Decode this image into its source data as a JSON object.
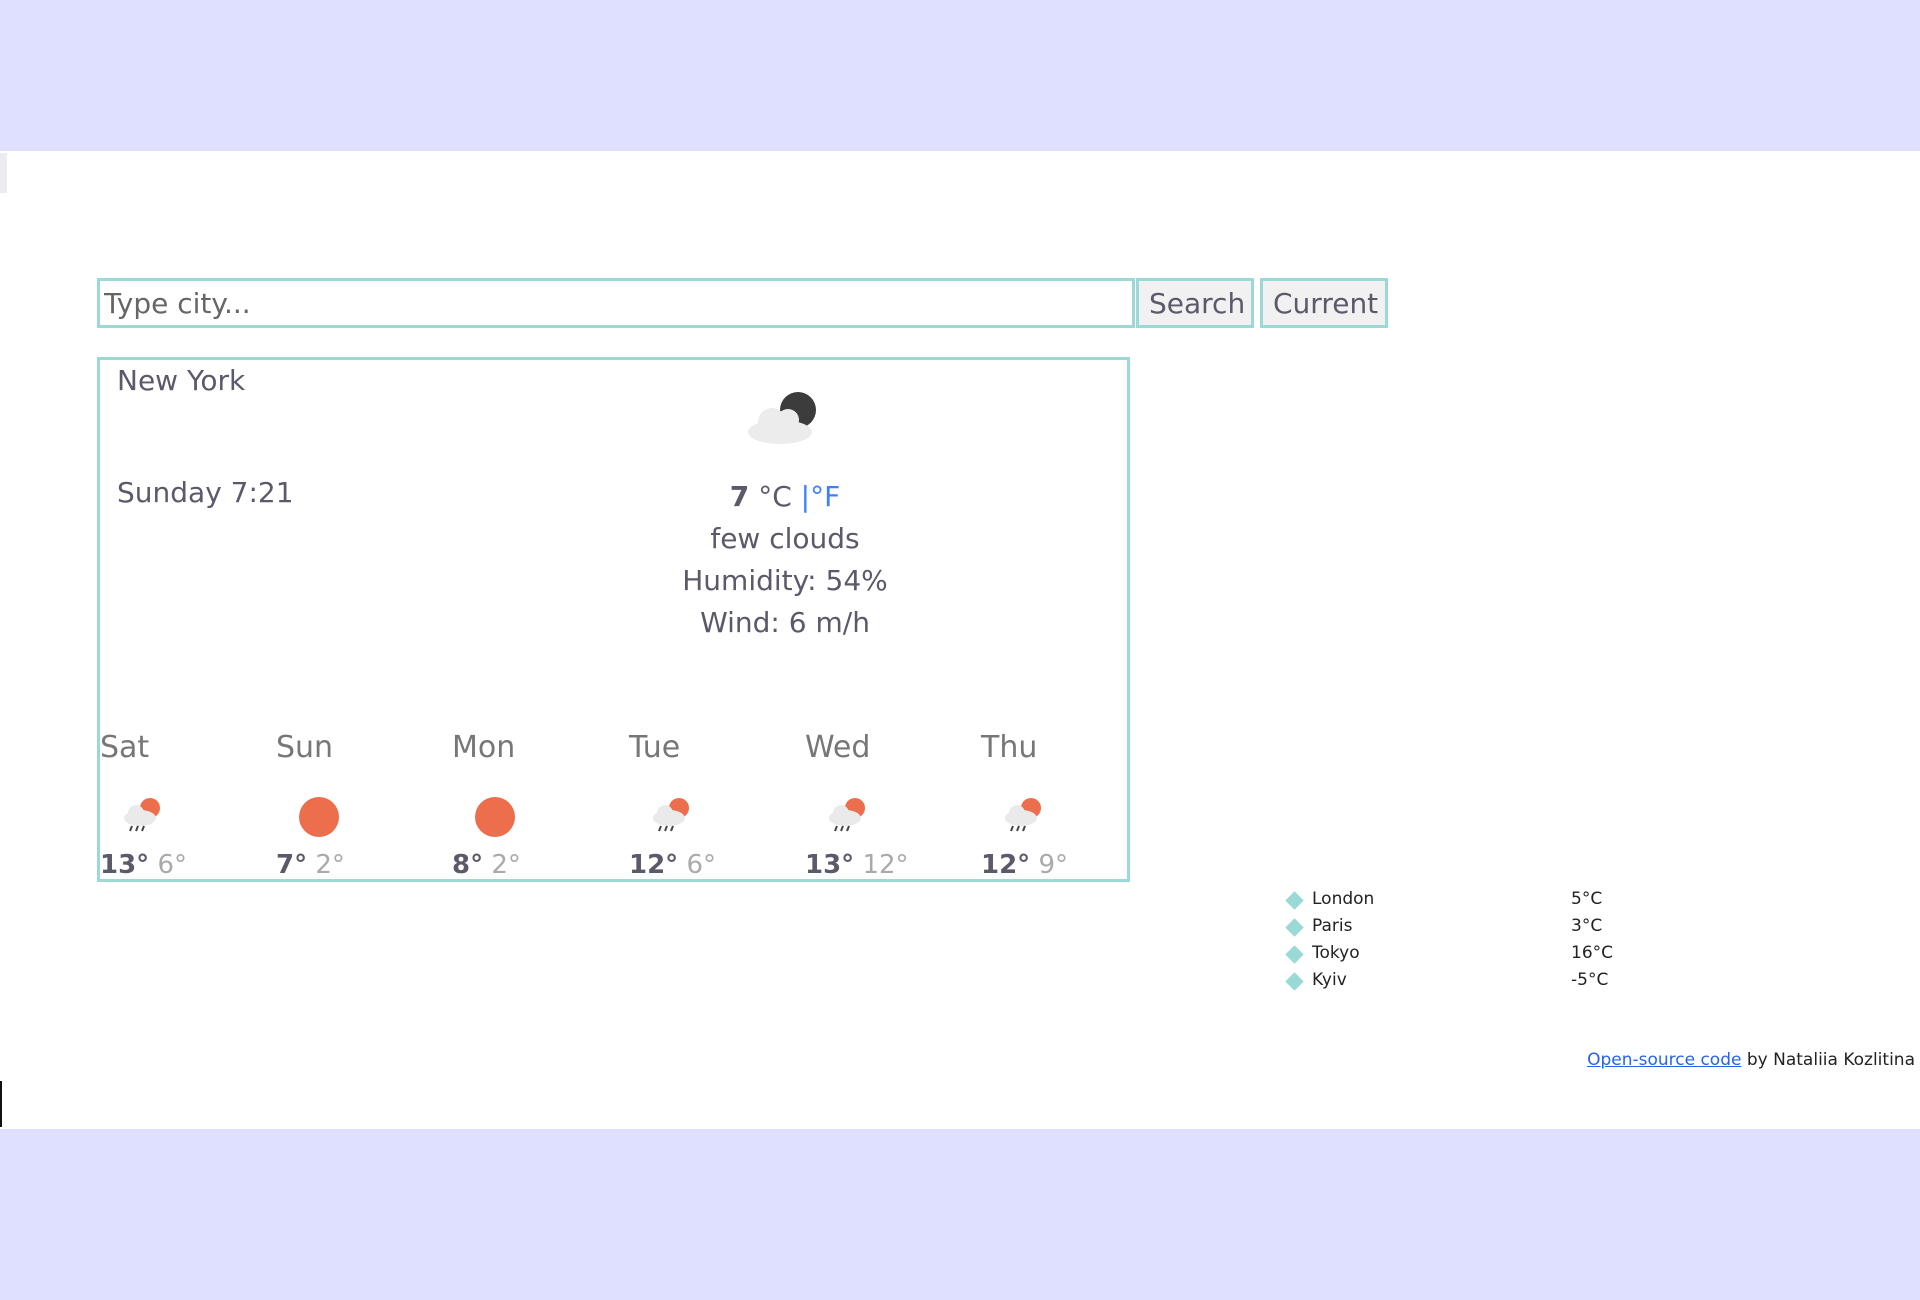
{
  "search": {
    "placeholder": "Type city...",
    "value": "",
    "search_label": "Search",
    "current_label": "Current"
  },
  "current": {
    "city": "New York",
    "datetime": "Sunday 7:21",
    "icon": "few-clouds-night-icon",
    "temperature": "7",
    "unit_c": "°C",
    "unit_sep": "|",
    "unit_f": "°F",
    "description": "few clouds",
    "humidity": "Humidity: 54%",
    "wind": "Wind: 6 m/h"
  },
  "forecast": [
    {
      "day": "Sat",
      "icon": "rain-sun-icon",
      "max": "13°",
      "min": "6°"
    },
    {
      "day": "Sun",
      "icon": "sun-icon",
      "max": "7°",
      "min": "2°"
    },
    {
      "day": "Mon",
      "icon": "sun-icon",
      "max": "8°",
      "min": "2°"
    },
    {
      "day": "Tue",
      "icon": "rain-sun-icon",
      "max": "12°",
      "min": "6°"
    },
    {
      "day": "Wed",
      "icon": "rain-sun-icon",
      "max": "13°",
      "min": "12°"
    },
    {
      "day": "Thu",
      "icon": "rain-sun-icon",
      "max": "12°",
      "min": "9°"
    }
  ],
  "cities": [
    {
      "name": "London",
      "temp": "5°C"
    },
    {
      "name": "Paris",
      "temp": "3°C"
    },
    {
      "name": "Tokyo",
      "temp": "16°C"
    },
    {
      "name": "Kyiv",
      "temp": "-5°C"
    }
  ],
  "footer": {
    "link": "Open-source code",
    "text": " by Nataliia Kozlitina"
  },
  "colors": {
    "accent": "#9ad9d5",
    "sun": "#ec6e4c",
    "background": "#dfdfff",
    "link": "#2563eb"
  }
}
